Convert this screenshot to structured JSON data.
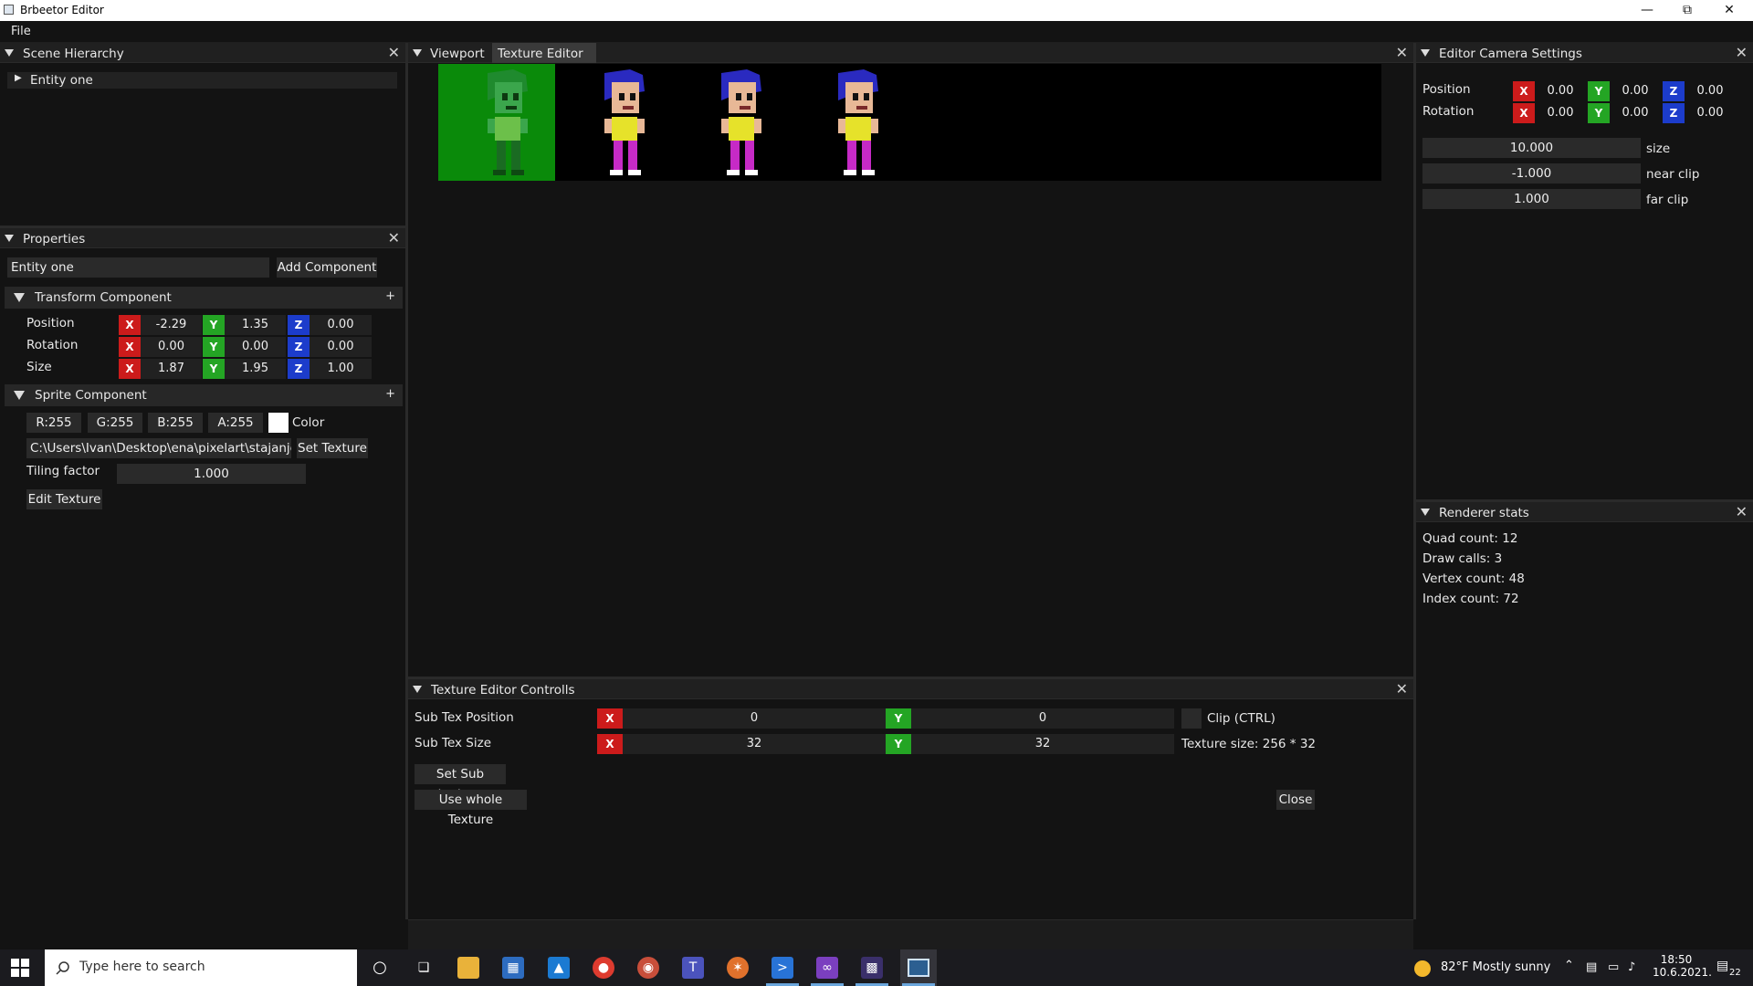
{
  "window": {
    "title": "Brbeetor Editor"
  },
  "menu": {
    "file": "File"
  },
  "scene_hierarchy": {
    "title": "Scene Hierarchy",
    "entity": "Entity one"
  },
  "properties": {
    "title": "Properties",
    "entity_name": "Entity one",
    "add_component": "Add Component",
    "transform": {
      "title": "Transform Component",
      "plus": "+",
      "rows": [
        {
          "label": "Position",
          "x": "-2.29",
          "y": "1.35",
          "z": "0.00"
        },
        {
          "label": "Rotation",
          "x": "0.00",
          "y": "0.00",
          "z": "0.00"
        },
        {
          "label": "Size",
          "x": "1.87",
          "y": "1.95",
          "z": "1.00"
        }
      ]
    },
    "sprite": {
      "title": "Sprite Component",
      "plus": "+",
      "r": "R:255",
      "g": "G:255",
      "b": "B:255",
      "a": "A:255",
      "color_label": "Color",
      "color_swatch": "#ffffff",
      "texture_path": "C:\\Users\\Ivan\\Desktop\\ena\\pixelart\\stajanje.p",
      "set_texture": "Set Texture",
      "tiling_label": "Tiling factor",
      "tiling_value": "1.000",
      "edit_texture": "Edit Texture"
    }
  },
  "center": {
    "tabs": [
      {
        "label": "Viewport"
      },
      {
        "label": "Texture Editor"
      }
    ],
    "active_tab": "Texture Editor",
    "texture_frames": 4,
    "selected_frame": 0,
    "selection_color": "#0a8a0a"
  },
  "texture_controls": {
    "title": "Texture Editor Controlls",
    "pos_label": "Sub Tex Position",
    "size_label": "Sub Tex Size",
    "pos_x": "0",
    "pos_y": "0",
    "size_x": "32",
    "size_y": "32",
    "clip_label": "Clip (CTRL)",
    "texture_size": "Texture size: 256 * 32",
    "set_sub": "Set Sub texture",
    "use_whole": "Use whole Texture",
    "close": "Close"
  },
  "camera": {
    "title": "Editor Camera Settings",
    "position_label": "Position",
    "rotation_label": "Rotation",
    "pos": {
      "x": "0.00",
      "y": "0.00",
      "z": "0.00"
    },
    "rot": {
      "x": "0.00",
      "y": "0.00",
      "z": "0.00"
    },
    "size_val": "10.000",
    "size_label": "size",
    "near_val": "-1.000",
    "near_label": "near clip",
    "far_val": "1.000",
    "far_label": "far clip"
  },
  "stats": {
    "title": "Renderer stats",
    "quad": "Quad count: 12",
    "draw": "Draw calls: 3",
    "vertex": "Vertex count: 48",
    "index": "Index count: 72"
  },
  "taskbar": {
    "search_placeholder": "Type here to search",
    "weather": "82°F  Mostly sunny",
    "time": "18:50",
    "date": "10.6.2021.",
    "notifications": "22"
  },
  "colors": {
    "x_axis": "#cc1b1b",
    "y_axis": "#24a524",
    "z_axis": "#1c3ccb"
  }
}
